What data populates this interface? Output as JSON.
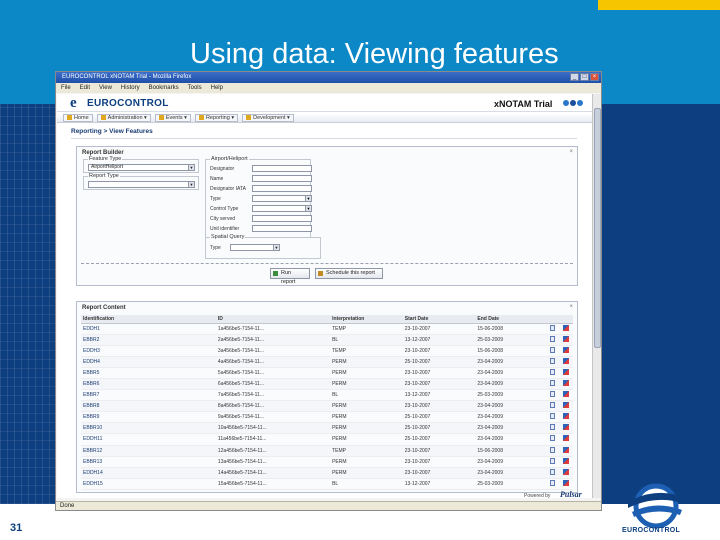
{
  "slide": {
    "title": "Using data: Viewing features",
    "page_number": "31",
    "brand": "EUROCONTROL",
    "colors": {
      "header_blue": "#0d88c7",
      "navy": "#0d3e7f",
      "accent_yellow": "#f7c400"
    }
  },
  "browser": {
    "window_title": "EUROCONTROL xNOTAM Trial - Mozilla Firefox",
    "menu": [
      "File",
      "Edit",
      "View",
      "History",
      "Bookmarks",
      "Tools",
      "Help"
    ],
    "status": "Done"
  },
  "app": {
    "brand": "EUROCONTROL",
    "product": "xNOTAM Trial",
    "nav": [
      "Home",
      "Administration",
      "Events",
      "Reporting",
      "Development"
    ],
    "breadcrumb": "Reporting > View Features"
  },
  "builder": {
    "title": "Report Builder",
    "feature_type_legend": "Feature Type",
    "feature_type_value": "AirportHeliport",
    "report_type_legend": "Report Type",
    "report_type_value": "",
    "airport_legend": "Airport/Heliport",
    "fields": [
      "Designator",
      "Name",
      "Designator IATA",
      "Type",
      "Control Type",
      "City served",
      "Unit identifier"
    ],
    "spatial_legend": "Spatial Query",
    "spatial_type_label": "Type",
    "run_button": "Run report",
    "schedule_button": "Schedule this report"
  },
  "content": {
    "title": "Report Content",
    "columns": [
      "Identification",
      "ID",
      "Interpretation",
      "Start Date",
      "End Date"
    ],
    "rows": [
      [
        "EDDH1",
        "1a456be5-7154-11...",
        "TEMP",
        "23-10-2007",
        "15-06-2008"
      ],
      [
        "EBBR2",
        "2a456be5-7154-11...",
        "BL",
        "13-12-2007",
        "25-03-2009"
      ],
      [
        "EDDH3",
        "3a456be5-7154-11...",
        "TEMP",
        "23-10-2007",
        "15-06-2008"
      ],
      [
        "EDDH4",
        "4a456be5-7154-11...",
        "PERM",
        "25-10-2007",
        "23-04-2009"
      ],
      [
        "EBBR5",
        "5a456be5-7154-11...",
        "PERM",
        "23-10-2007",
        "23-04-2009"
      ],
      [
        "EBBR6",
        "6a456be5-7154-11...",
        "PERM",
        "23-10-2007",
        "23-04-2009"
      ],
      [
        "EBBR7",
        "7a456be5-7154-11...",
        "BL",
        "13-12-2007",
        "25-03-2009"
      ],
      [
        "EBBR8",
        "8a456be5-7154-11...",
        "PERM",
        "23-10-2007",
        "23-04-2009"
      ],
      [
        "EBBR9",
        "9a456be5-7154-11...",
        "PERM",
        "25-10-2007",
        "23-04-2009"
      ],
      [
        "EBBR10",
        "10a456be5-7154-11...",
        "PERM",
        "25-10-2007",
        "23-04-2009"
      ],
      [
        "EDDH11",
        "11a456be5-7154-11...",
        "PERM",
        "25-10-2007",
        "23-04-2009"
      ],
      [
        "EBBR12",
        "12a456be5-7154-11...",
        "TEMP",
        "23-10-2007",
        "15-06-2008"
      ],
      [
        "EBBR13",
        "13a456be5-7154-11...",
        "PERM",
        "23-10-2007",
        "23-04-2009"
      ],
      [
        "EDDH14",
        "14a456be5-7154-11...",
        "PERM",
        "23-10-2007",
        "23-04-2009"
      ],
      [
        "EDDH15",
        "15a456be5-7154-11...",
        "BL",
        "13-12-2007",
        "25-03-2009"
      ]
    ],
    "powered_by": "Powered by",
    "pulsar": "Pulsar"
  }
}
